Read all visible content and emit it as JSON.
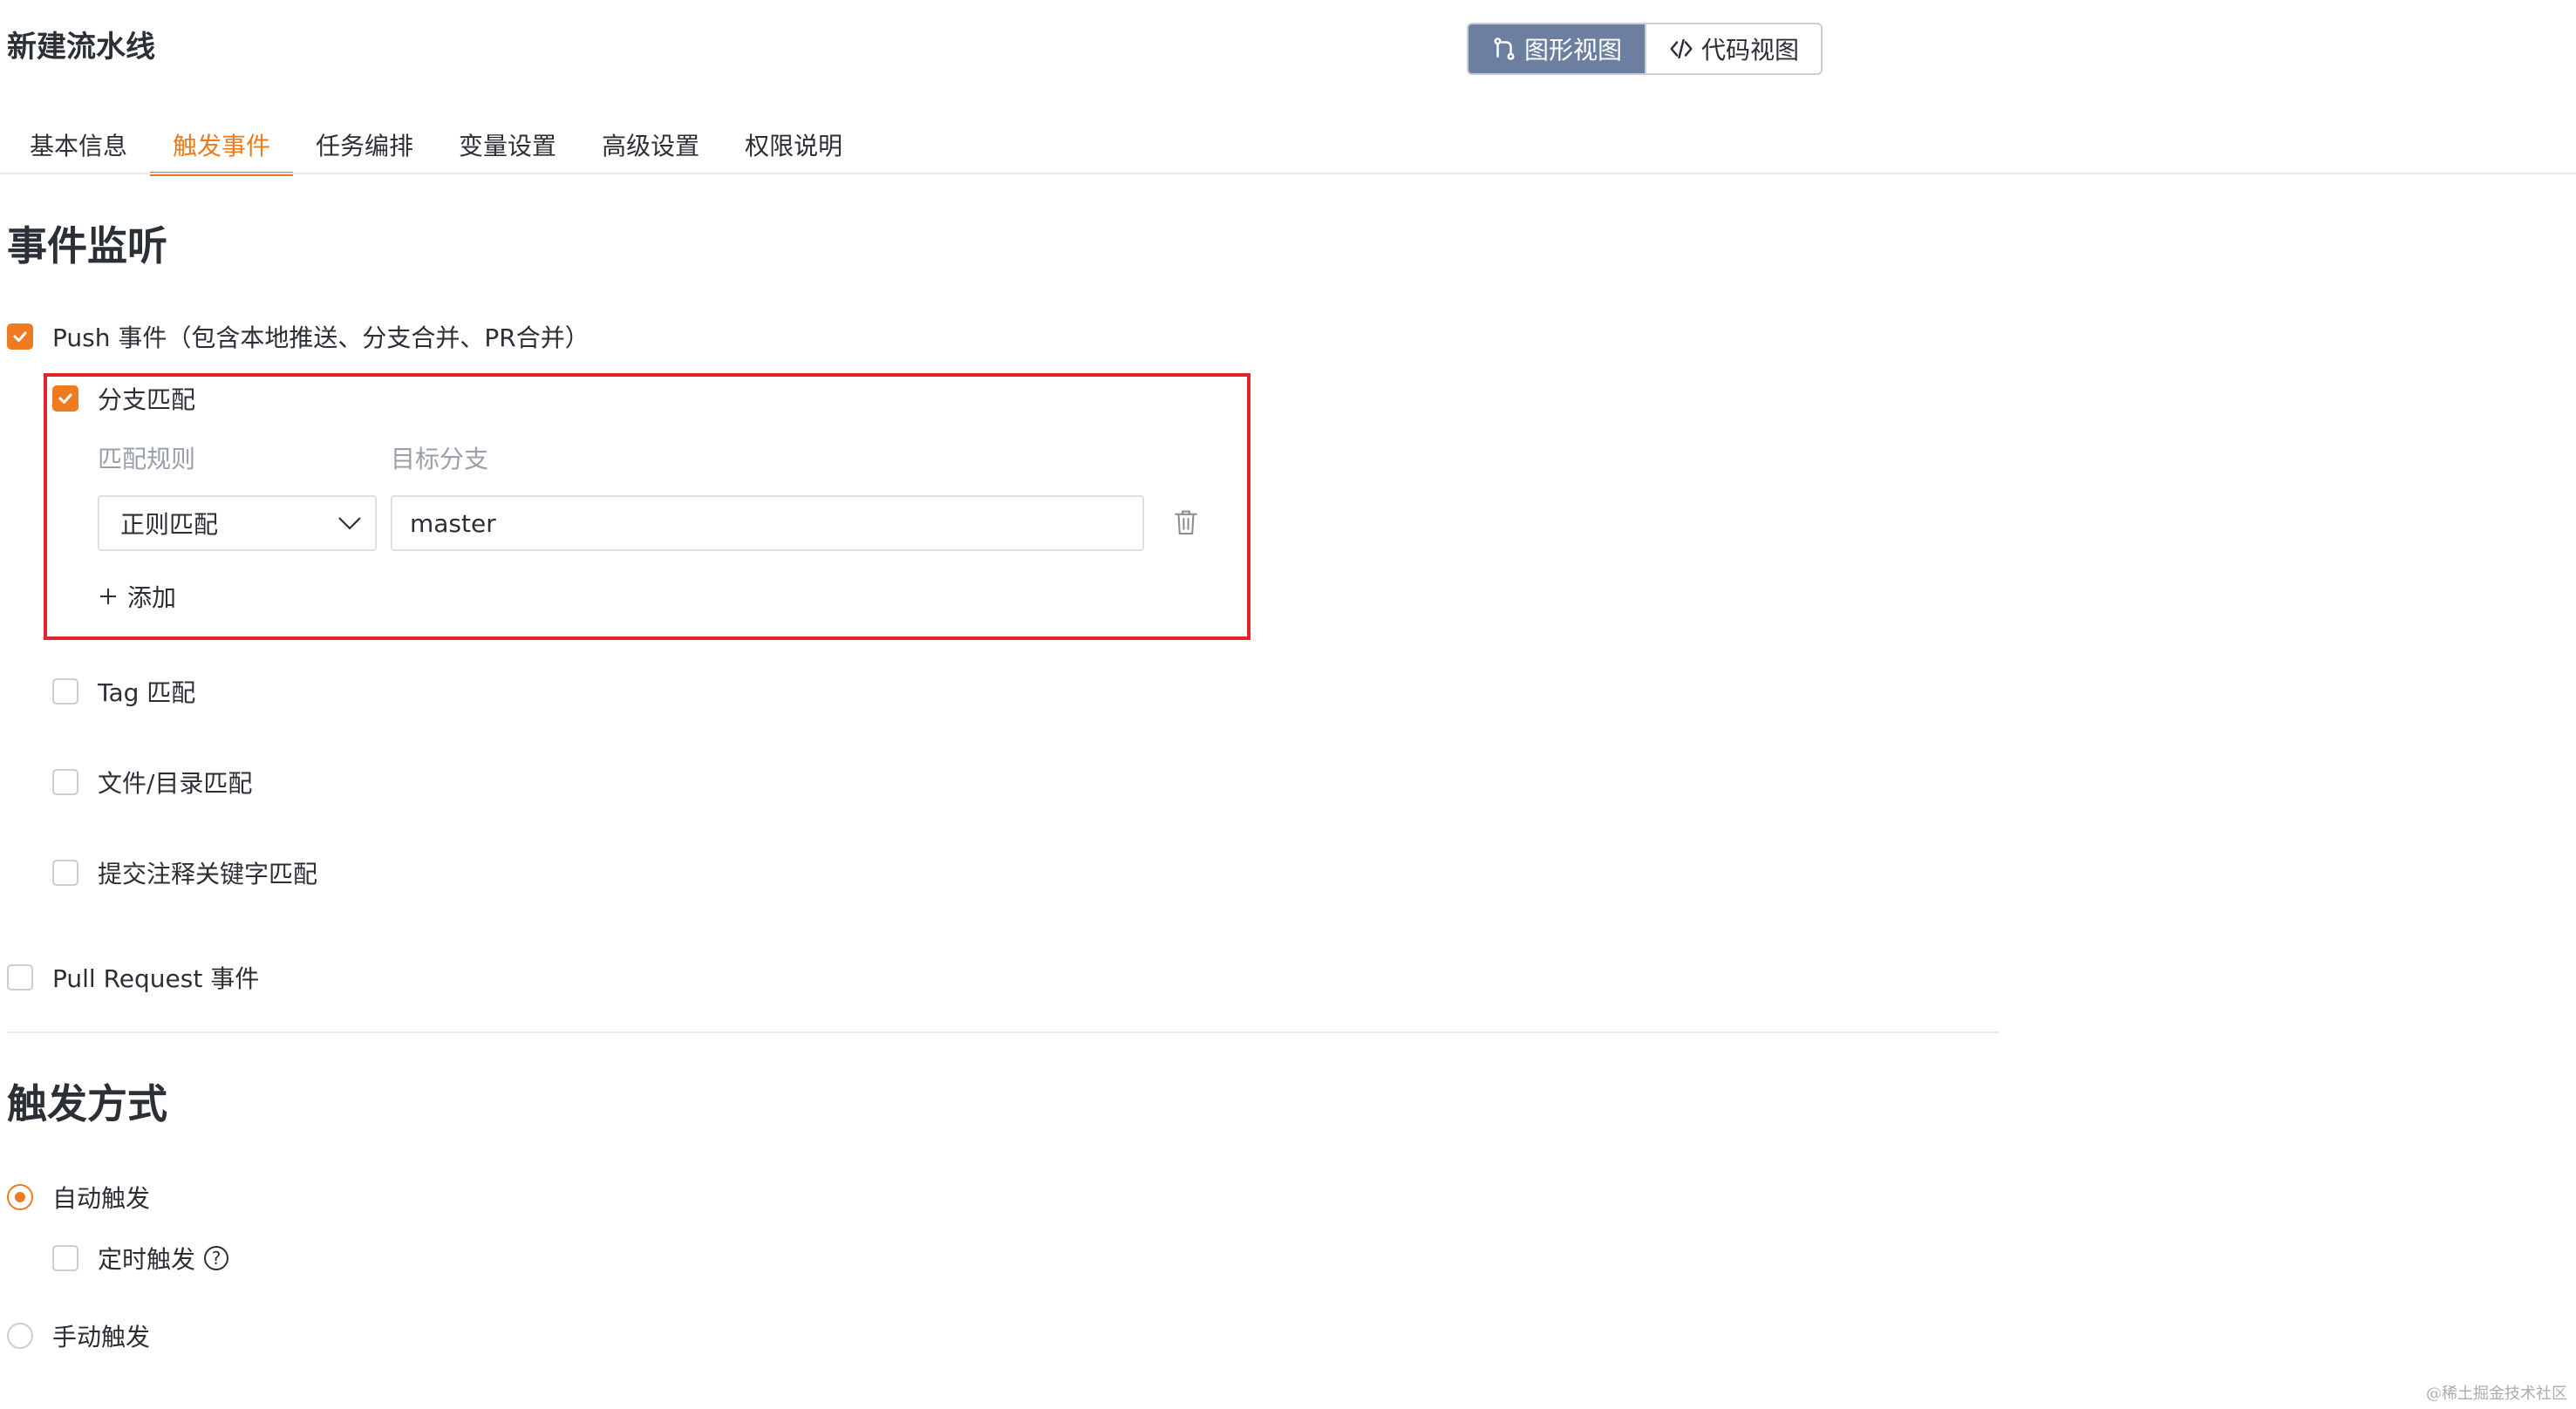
{
  "header": {
    "title": "新建流水线",
    "view_toggle": {
      "graphic_label": "图形视图",
      "code_label": "代码视图",
      "active": "graphic"
    }
  },
  "tabs": [
    {
      "label": "基本信息",
      "active": false
    },
    {
      "label": "触发事件",
      "active": true
    },
    {
      "label": "任务编排",
      "active": false
    },
    {
      "label": "变量设置",
      "active": false
    },
    {
      "label": "高级设置",
      "active": false
    },
    {
      "label": "权限说明",
      "active": false
    }
  ],
  "event_listening": {
    "title": "事件监听",
    "push_event": {
      "label": "Push 事件（包含本地推送、分支合并、PR合并）",
      "checked": true
    },
    "branch_match": {
      "label": "分支匹配",
      "checked": true,
      "rule_label": "匹配规则",
      "target_label": "目标分支",
      "rule_value": "正则匹配",
      "target_value": "master",
      "add_label": "添加"
    },
    "tag_match": {
      "label": "Tag 匹配",
      "checked": false
    },
    "file_match": {
      "label": "文件/目录匹配",
      "checked": false
    },
    "commit_match": {
      "label": "提交注释关键字匹配",
      "checked": false
    },
    "pull_request": {
      "label": "Pull Request 事件",
      "checked": false
    }
  },
  "trigger_mode": {
    "title": "触发方式",
    "auto": {
      "label": "自动触发",
      "selected": true
    },
    "scheduled": {
      "label": "定时触发",
      "checked": false,
      "help_glyph": "?"
    },
    "manual": {
      "label": "手动触发",
      "selected": false
    }
  },
  "watermark": "@稀土掘金技术社区",
  "colors": {
    "accent": "#ee7b1f",
    "highlight_border": "#e0262b",
    "toggle_active_bg": "#6c7fa0"
  }
}
